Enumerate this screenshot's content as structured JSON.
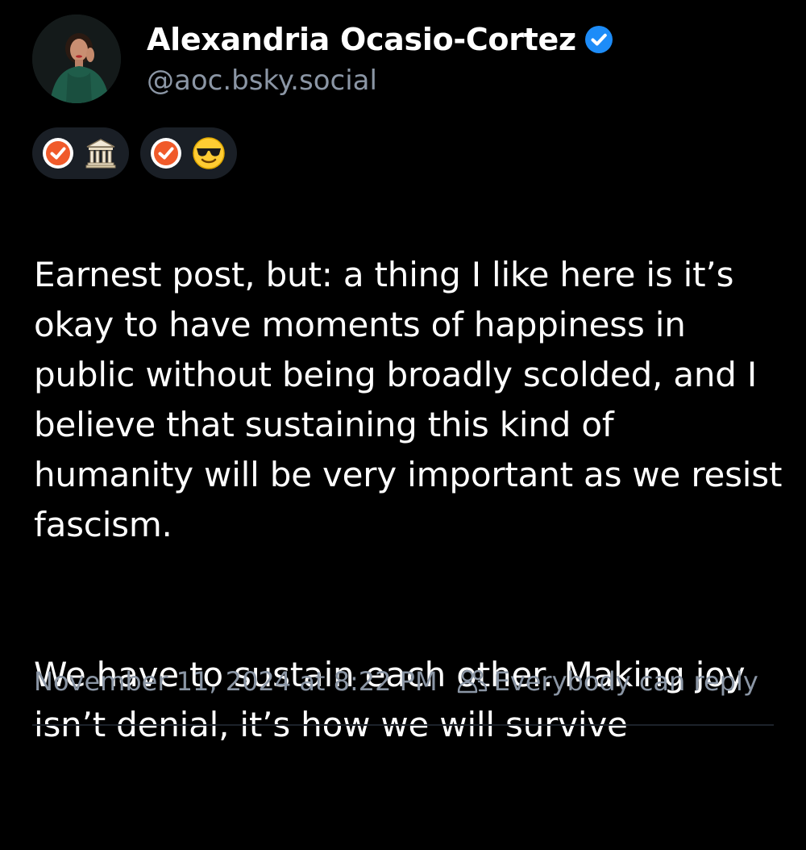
{
  "author": {
    "display_name": "Alexandria Ocasio-Cortez",
    "handle": "@aoc.bsky.social",
    "verified": true,
    "avatar": "profile-photo"
  },
  "badges": [
    {
      "icons": [
        "check-badge-icon",
        "bank-building-emoji"
      ]
    },
    {
      "icons": [
        "check-badge-icon",
        "sunglasses-face-emoji"
      ]
    }
  ],
  "post": {
    "paragraphs": [
      "Earnest post, but: a thing I like here is it’s okay to have moments of happiness in public without being broadly scolded, and I believe that sustaining this kind of humanity will be very important as we resist fascism.",
      "We have to sustain each other. Making joy isn’t denial, it’s how we will survive"
    ]
  },
  "meta": {
    "timestamp": "November 11, 2024 at 8:22 PM",
    "reply_setting": "Everybody can reply"
  },
  "colors": {
    "background": "#000000",
    "text": "#ffffff",
    "muted": "#8b96a5",
    "verified_blue": "#1d8cf8",
    "badge_orange": "#f05a2a",
    "pill_bg": "#1a1f26"
  }
}
